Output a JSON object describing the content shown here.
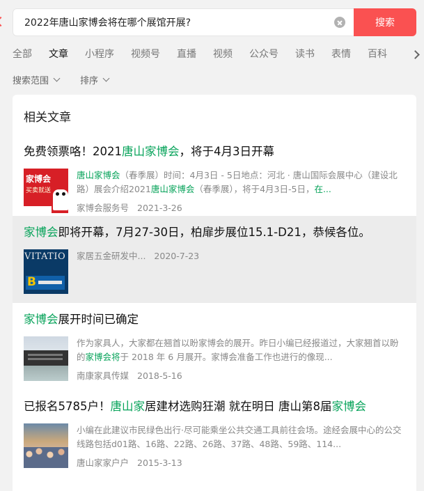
{
  "search": {
    "query": "2022年唐山家博会将在哪个展馆开展?",
    "button_label": "搜索"
  },
  "tabs": [
    {
      "label": "全部",
      "active": false
    },
    {
      "label": "文章",
      "active": true
    },
    {
      "label": "小程序",
      "active": false
    },
    {
      "label": "视频号",
      "active": false
    },
    {
      "label": "直播",
      "active": false
    },
    {
      "label": "视频",
      "active": false
    },
    {
      "label": "公众号",
      "active": false
    },
    {
      "label": "读书",
      "active": false
    },
    {
      "label": "表情",
      "active": false
    },
    {
      "label": "百科",
      "active": false
    }
  ],
  "filters": {
    "scope_label": "搜索范围",
    "sort_label": "排序"
  },
  "section_title": "相关文章",
  "results": [
    {
      "title": [
        {
          "text": "免费领票咯！2021",
          "hl": false
        },
        {
          "text": "唐山家博会",
          "hl": true
        },
        {
          "text": "，将于4月3日开幕",
          "hl": false
        }
      ],
      "snippet": [
        {
          "text": "唐山家博会",
          "hl": true
        },
        {
          "text": "（春季展）时间：4月3日 - 5日地点：河北 · 唐山国际会展中心（建设北路）展会介绍2021",
          "hl": false
        },
        {
          "text": "唐山家博会",
          "hl": true
        },
        {
          "text": "（春季展），将于4月3日-5日，",
          "hl": false
        },
        {
          "text": "在...",
          "hl": true
        }
      ],
      "thumb_text": [
        "家博会",
        "买卖就送"
      ],
      "source": "家博会服务号",
      "date": "2021-3-26",
      "highlighted": false
    },
    {
      "title": [
        {
          "text": "家博会",
          "hl": true
        },
        {
          "text": "即将开幕，7月27-30日，柏扉步展位15.1-D21，恭候各位。",
          "hl": false
        }
      ],
      "snippet": [],
      "thumb_text": [
        "VITATIO"
      ],
      "source": "家居五金研发中...",
      "date": "2020-7-23",
      "highlighted": true
    },
    {
      "title": [
        {
          "text": "家博会",
          "hl": true
        },
        {
          "text": "展开时间已确定",
          "hl": false
        }
      ],
      "snippet": [
        {
          "text": "作为家具人，大家都在翘首以盼家博会的展开。昨日小编已经报道过，大家翘首以盼的",
          "hl": false
        },
        {
          "text": "家博会将",
          "hl": true
        },
        {
          "text": "于 2018 年 6 月展开。家博会准备工作也进行的像现...",
          "hl": false
        }
      ],
      "thumb_text": [],
      "source": "南康家具传媒",
      "date": "2018-5-16",
      "highlighted": false
    },
    {
      "title": [
        {
          "text": "已报名5785户！",
          "hl": false
        },
        {
          "text": "唐山家",
          "hl": true
        },
        {
          "text": "居建材选购狂潮 就在明日 唐山第8届",
          "hl": false
        },
        {
          "text": "家博会",
          "hl": true
        }
      ],
      "snippet": [
        {
          "text": "小编在此建议市民绿色出行·尽可能乘坐公共交通工具前往会场。途经会展中心的公交线路包括d01路、16路、22路、26路、37路、48路、59路、114...",
          "hl": false
        }
      ],
      "thumb_text": [],
      "source": "唐山家家户户",
      "date": "2015-3-13",
      "highlighted": false
    }
  ]
}
